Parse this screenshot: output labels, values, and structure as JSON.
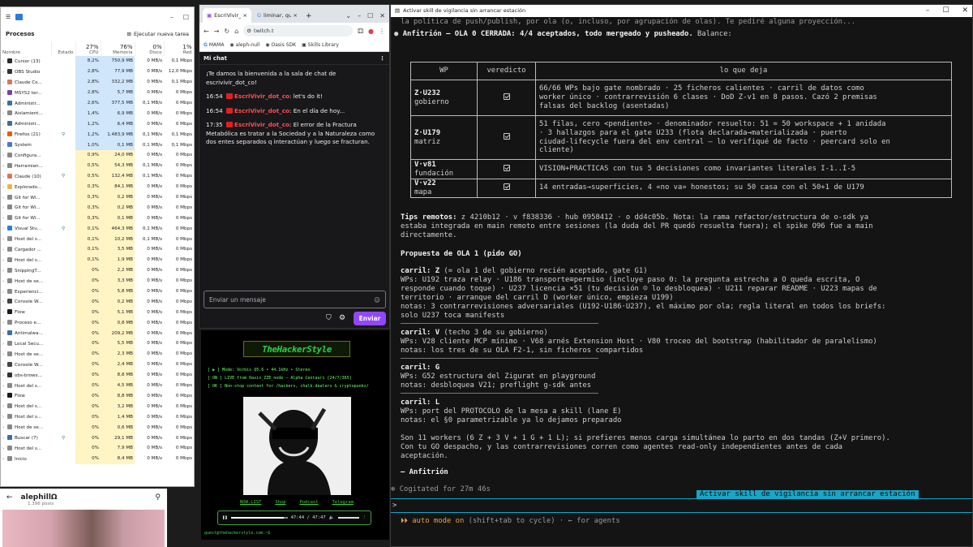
{
  "task_manager": {
    "app": "Administrador de tareas",
    "section_title": "Procesos",
    "new_task": "Ejecutar nueva tarea",
    "columns": {
      "name": "Nombre",
      "status": "Estado",
      "cpu_pct": "27%",
      "cpu": "CPU",
      "mem_pct": "76%",
      "mem": "Memoria",
      "disk_pct": "0%",
      "disk": "Disco",
      "net_pct": "1%",
      "net": "Red"
    },
    "rows": [
      {
        "name": "Cursor (13)",
        "st": "",
        "cpu": "8,2%",
        "mem": "750,9 MB",
        "disk": "0 MB/s",
        "net": "0,1 Mbps",
        "color": "#2a2a2a"
      },
      {
        "name": "OBS Studio",
        "st": "",
        "cpu": "2,8%",
        "mem": "77,9 MB",
        "disk": "0 MB/s",
        "net": "12,0 Mbps",
        "color": "#333"
      },
      {
        "name": "Claude Co...",
        "st": "",
        "cpu": "2,8%",
        "mem": "332,2 MB",
        "disk": "0 MB/s",
        "net": "0,1 Mbps",
        "color": "#d97757"
      },
      {
        "name": "MSYS2 ter...",
        "st": "",
        "cpu": "2,8%",
        "mem": "5,7 MB",
        "disk": "0 MB/s",
        "net": "0 Mbps",
        "color": "#7a3fa0"
      },
      {
        "name": "Administr...",
        "st": "",
        "cpu": "2,6%",
        "mem": "377,5 MB",
        "disk": "0,1 MB/s",
        "net": "0 Mbps",
        "color": "#3a6ea5"
      },
      {
        "name": "Aislamient...",
        "st": "",
        "cpu": "1,4%",
        "mem": "6,9 MB",
        "disk": "0 MB/s",
        "net": "0 Mbps",
        "color": "#888"
      },
      {
        "name": "Administr...",
        "st": "",
        "cpu": "1,2%",
        "mem": "6,4 MB",
        "disk": "0 MB/s",
        "net": "0 Mbps",
        "color": "#3a6ea5"
      },
      {
        "name": "Firefox (21)",
        "st": "⚲",
        "cpu": "1,2%",
        "mem": "1.483,9 MB",
        "disk": "0,1 MB/s",
        "net": "0,1 Mbps",
        "color": "#e66000"
      },
      {
        "name": "System",
        "st": "",
        "cpu": "1,0%",
        "mem": "0,1 MB",
        "disk": "0,1 MB/s",
        "net": "0,1 Mbps",
        "color": "#4a79c4"
      },
      {
        "name": "Configura...",
        "st": "",
        "cpu": "0,9%",
        "mem": "24,0 MB",
        "disk": "0 MB/s",
        "net": "0 Mbps",
        "color": "#888"
      },
      {
        "name": "Herramien...",
        "st": "",
        "cpu": "0,5%",
        "mem": "54,3 MB",
        "disk": "0,1 MB/s",
        "net": "0 Mbps",
        "color": "#888"
      },
      {
        "name": "Claude (10)",
        "st": "⚲",
        "cpu": "0,5%",
        "mem": "132,4 MB",
        "disk": "0,1 MB/s",
        "net": "0 Mbps",
        "color": "#d97757"
      },
      {
        "name": "Explorado...",
        "st": "",
        "cpu": "0,3%",
        "mem": "84,1 MB",
        "disk": "0 MB/s",
        "net": "0 Mbps",
        "color": "#e8b84a"
      },
      {
        "name": "Git for Wi...",
        "st": "",
        "cpu": "0,3%",
        "mem": "0,2 MB",
        "disk": "0 MB/s",
        "net": "0 Mbps",
        "color": "#888"
      },
      {
        "name": "Git for Wi...",
        "st": "",
        "cpu": "0,3%",
        "mem": "0,2 MB",
        "disk": "0 MB/s",
        "net": "0 Mbps",
        "color": "#888"
      },
      {
        "name": "Git for Wi...",
        "st": "",
        "cpu": "0,3%",
        "mem": "0,1 MB",
        "disk": "0 MB/s",
        "net": "0 Mbps",
        "color": "#888"
      },
      {
        "name": "Visual Stu...",
        "st": "⚲",
        "cpu": "0,1%",
        "mem": "464,3 MB",
        "disk": "0,1 MB/s",
        "net": "0 Mbps",
        "color": "#2f7ed8"
      },
      {
        "name": "Host del s...",
        "st": "",
        "cpu": "0,1%",
        "mem": "10,2 MB",
        "disk": "0,1 MB/s",
        "net": "0 Mbps",
        "color": "#888"
      },
      {
        "name": "Cargador ...",
        "st": "",
        "cpu": "0,1%",
        "mem": "3,5 MB",
        "disk": "0 MB/s",
        "net": "0 Mbps",
        "color": "#888"
      },
      {
        "name": "Host del s...",
        "st": "",
        "cpu": "0,1%",
        "mem": "1,9 MB",
        "disk": "0 MB/s",
        "net": "0 Mbps",
        "color": "#888"
      },
      {
        "name": "SnippingT...",
        "st": "",
        "cpu": "0%",
        "mem": "2,2 MB",
        "disk": "0 MB/s",
        "net": "0 Mbps",
        "color": "#888"
      },
      {
        "name": "Host de se...",
        "st": "",
        "cpu": "0%",
        "mem": "3,3 MB",
        "disk": "0 MB/s",
        "net": "0 Mbps",
        "color": "#888"
      },
      {
        "name": "Experienci...",
        "st": "",
        "cpu": "0%",
        "mem": "5,8 MB",
        "disk": "0 MB/s",
        "net": "0 Mbps",
        "color": "#888"
      },
      {
        "name": "Console W...",
        "st": "",
        "cpu": "0%",
        "mem": "0,2 MB",
        "disk": "0 MB/s",
        "net": "0 Mbps",
        "color": "#444"
      },
      {
        "name": "Flow",
        "st": "",
        "cpu": "0%",
        "mem": "5,1 MB",
        "disk": "0 MB/s",
        "net": "0 Mbps",
        "color": "#1a1a1a"
      },
      {
        "name": "Proceso e...",
        "st": "",
        "cpu": "0%",
        "mem": "0,8 MB",
        "disk": "0 MB/s",
        "net": "0 Mbps",
        "color": "#888"
      },
      {
        "name": "Antimalwa...",
        "st": "",
        "cpu": "0%",
        "mem": "209,2 MB",
        "disk": "0 MB/s",
        "net": "0 Mbps",
        "color": "#3a6ea5"
      },
      {
        "name": "Local Secu...",
        "st": "",
        "cpu": "0%",
        "mem": "5,5 MB",
        "disk": "0 MB/s",
        "net": "0 Mbps",
        "color": "#888"
      },
      {
        "name": "Host de se...",
        "st": "",
        "cpu": "0%",
        "mem": "2,3 MB",
        "disk": "0 MB/s",
        "net": "0 Mbps",
        "color": "#888"
      },
      {
        "name": "Console W...",
        "st": "",
        "cpu": "0%",
        "mem": "2,4 MB",
        "disk": "0 MB/s",
        "net": "0 Mbps",
        "color": "#444"
      },
      {
        "name": "obs-brows...",
        "st": "",
        "cpu": "0%",
        "mem": "8,8 MB",
        "disk": "0 MB/s",
        "net": "0 Mbps",
        "color": "#333"
      },
      {
        "name": "Host del s...",
        "st": "",
        "cpu": "0%",
        "mem": "4,5 MB",
        "disk": "0 MB/s",
        "net": "0 Mbps",
        "color": "#888"
      },
      {
        "name": "Flow",
        "st": "",
        "cpu": "0%",
        "mem": "8,8 MB",
        "disk": "0 MB/s",
        "net": "0 Mbps",
        "color": "#1a1a1a"
      },
      {
        "name": "Host del s...",
        "st": "",
        "cpu": "0%",
        "mem": "3,2 MB",
        "disk": "0 MB/s",
        "net": "0 Mbps",
        "color": "#888"
      },
      {
        "name": "Host del s...",
        "st": "",
        "cpu": "0%",
        "mem": "1,4 MB",
        "disk": "0 MB/s",
        "net": "0 Mbps",
        "color": "#888"
      },
      {
        "name": "Host de se...",
        "st": "",
        "cpu": "0%",
        "mem": "0,6 MB",
        "disk": "0 MB/s",
        "net": "0 Mbps",
        "color": "#888"
      },
      {
        "name": "Buscar (7)",
        "st": "⚲",
        "cpu": "0%",
        "mem": "29,1 MB",
        "disk": "0 MB/s",
        "net": "0 Mbps",
        "color": "#3a6ea5"
      },
      {
        "name": "Host del s...",
        "st": "",
        "cpu": "0%",
        "mem": "7,9 MB",
        "disk": "0 MB/s",
        "net": "0 Mbps",
        "color": "#888"
      },
      {
        "name": "Inicio",
        "st": "",
        "cpu": "0%",
        "mem": "8,4 MB",
        "disk": "0 MB/s",
        "net": "0 Mbps",
        "color": "#888"
      }
    ]
  },
  "chat_browser": {
    "tab1": "EscriVivir_",
    "tab2": "liminar, que ",
    "url": "twitch.t",
    "bookmarks": [
      "MAMA",
      "aleph-null",
      "Oasis SDK",
      "Skills Library"
    ],
    "chat_title": "Mi chat",
    "welcome": "¡Te damos la bienvenida a la sala de chat de escrivivir_dot_co!",
    "messages": [
      {
        "time": "16:54",
        "user": "EscriVivir_dot_co",
        "text": "let's do it!"
      },
      {
        "time": "16:54",
        "user": "EscriVivir_dot_co",
        "text": "En el día de hoy..."
      },
      {
        "time": "17:35",
        "user": "EscriVivir_dot_co",
        "text": "El error de la Fractura Metabólica es tratar a la Sociedad y a la Naturaleza como dos entes separados q interactúan y luego se fracturan."
      }
    ],
    "input_placeholder": "Enviar un mensaje",
    "send": "Enviar"
  },
  "hacker": {
    "logo": "TheHackerStyle",
    "lines": [
      "[ ▶ ] Mode: Vorbis Q5.6 • 44.1kHz • Stereo",
      "[ ON ] LIVE from Oasis_ZZE_node — Alpha Centauri [24/7/365]",
      "[ OK ] Non-stop content for /hackers, chalk.dealers & cryptopunks/"
    ],
    "links": [
      "NOW.LIST",
      "Shop",
      "Podcast",
      "Telegram"
    ],
    "time": "47:44 / 47:47",
    "progress": 0.94,
    "footer": "guest@thehackerstyle.com:~$"
  },
  "social": {
    "name": "alephillΩ",
    "posts": "1.396 posts"
  },
  "terminal": {
    "title": "Activar skill de vigilancia sin arrancar estación",
    "top_line": "la política de push/publish, por ola (o, incluso, por agrupación de olas). Te pediré alguna proyección...",
    "head_bold": "Anfitrión — OLA 0 CERRADA: 4/4 aceptados, todo mergeado y pusheado.",
    "head_rest": " Balance:",
    "table_headers": [
      "WP",
      "veredicto",
      "lo que deja"
    ],
    "table_rows": [
      {
        "wp": "Z·U232",
        "wp2": "gobierno",
        "text": [
          "66/66 WPs bajo gate nombrado · 25 ficheros calientes · carril de datos como",
          "worker único · contrarrevisión 6 clases · DoD Z-v1 en 8 pasos. Cazó 2 premisas",
          "falsas del backlog (asentadas)"
        ]
      },
      {
        "wp": "Z·U179",
        "wp2": "matriz",
        "text": [
          "51 filas, cero <pendiente> · denominador resuelto: 51 = 50 workspace + 1 anidada",
          "· 3 hallazgos para el gate U233 (flota declarada→materializada · puerto",
          "ciudad-lifecycle fuera del env central — lo verifiqué de facto · peercard solo en",
          "cliente)"
        ]
      },
      {
        "wp": "V·v81",
        "wp2": "fundación",
        "text": [
          "VISION+PRACTICAS con tus 5 decisiones como invariantes literales I-1..I-5"
        ]
      },
      {
        "wp": "V·v22",
        "wp2": "mapa",
        "text": [
          "14 entradas→superficies, 4 «no va» honestos; su 50 casa con el 50+1 de U179"
        ]
      }
    ],
    "tips_label": "Tips remotos:",
    "tips_line1": " z 4210b12 · v f838336 · hub 0958412 · o dd4c05b. Nota: la rama refactor/estructura de o-sdk ya",
    "tips_line2": "estaba integrada en main remoto entre sesiones (la duda del PR quedó resuelta fuera); el spike O96 fue a main",
    "tips_line3": "directamente.",
    "proposal": "Propuesta de OLA 1 (pido GO)",
    "carril_z": "carril: Z",
    "carril_z_rest": " (= ola 1 del gobierno recién aceptado, gate G1)",
    "z_wps1": "WPs: U192 traza relay · U186 transporte≡permiso (incluye paso 0: la pregunta estrecha a O queda escrita, O",
    "z_wps2": "responde cuando toque) · U237 licencia ×51 (tu decisión ☺ lo desbloquea) · U211 reparar README · U223 mapas de",
    "z_wps3": "territorio · arranque del carril D (worker único, empieza U199)",
    "z_notes1": "notas: 3 contrarrevisiones adversariales (U192·U186·U237), el máximo por ola; regla literal en todos los briefs:",
    "z_notes2": "solo U237 toca manifests",
    "carril_v": "carril: V",
    "carril_v_rest": " (techo 3 de su gobierno)",
    "v_wps": "WPs: V28 cliente MCP mínimo · V68 arnés Extension Host · V80 troceo del bootstrap (habilitador de paralelismo)",
    "v_notes": "notas: los tres de su OLA F2-1, sin ficheros compartidos",
    "carril_g": "carril: G",
    "g_wps": "WPs: G52 estructura del Zigurat en playground",
    "g_notes": "notas: desbloquea V21; preflight g-sdk antes",
    "carril_l": "carril: L",
    "l_wps": "WPs: port del PROTOCOLO de la mesa a skill (lane E)",
    "l_notes": "notas: el §0 parametrizable ya lo dejamos preparado",
    "sum1": "Son 11 workers (6 Z + 3 V + 1 G + 1 L); si prefieres menos carga simultánea lo parto en dos tandas (Z+V primero).",
    "sum2": "Con tu GO despacho, y las contrarrevisiones corren como agentes read-only independientes antes de cada",
    "sum3": "aceptación.",
    "sign": "— Anfitrión",
    "cogitated": "✻ Cogitated for 27m 46s",
    "banner": "Activar skill de vigilancia sin arrancar estación",
    "prompt": ">",
    "mode": "⏵⏵ auto mode on",
    "mode_rest": " (shift+tab to cycle) · ← for agents"
  }
}
